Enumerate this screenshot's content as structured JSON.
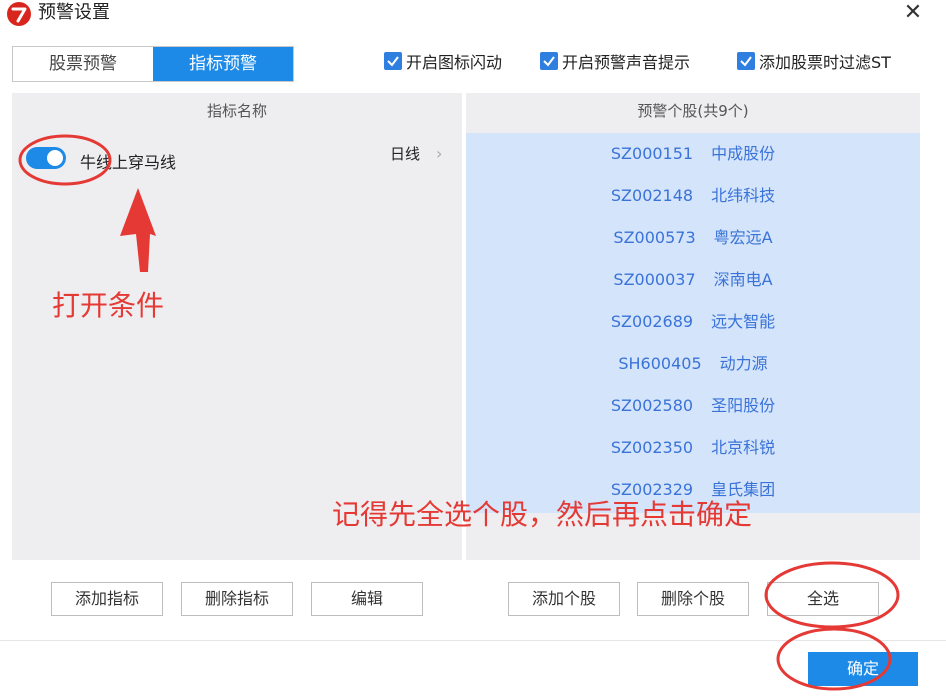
{
  "window": {
    "title": "预警设置",
    "close_glyph": "✕"
  },
  "tabs": [
    {
      "label": "股票预警",
      "active": false
    },
    {
      "label": "指标预警",
      "active": true
    }
  ],
  "options": [
    {
      "label": "开启图标闪动",
      "checked": true
    },
    {
      "label": "开启预警声音提示",
      "checked": true
    },
    {
      "label": "添加股票时过滤ST",
      "checked": true
    }
  ],
  "indicators": {
    "header": "指标名称",
    "items": [
      {
        "name": "牛线上穿马线",
        "period": "日线",
        "enabled": true
      }
    ]
  },
  "stocks": {
    "header": "预警个股(共9个)",
    "items": [
      {
        "code": "SZ000151",
        "name": "中成股份"
      },
      {
        "code": "SZ002148",
        "name": "北纬科技"
      },
      {
        "code": "SZ000573",
        "name": "粤宏远A"
      },
      {
        "code": "SZ000037",
        "name": "深南电A"
      },
      {
        "code": "SZ002689",
        "name": "远大智能"
      },
      {
        "code": "SH600405",
        "name": "动力源"
      },
      {
        "code": "SZ002580",
        "name": "圣阳股份"
      },
      {
        "code": "SZ002350",
        "name": "北京科锐"
      },
      {
        "code": "SZ002329",
        "name": "皇氏集团"
      }
    ]
  },
  "buttons": {
    "add_indicator": "添加指标",
    "delete_indicator": "删除指标",
    "edit": "编辑",
    "add_stock": "添加个股",
    "delete_stock": "删除个股",
    "select_all": "全选",
    "confirm": "确定"
  },
  "annotations": {
    "open_condition": "打开条件",
    "instruction": "记得先全选个股，然后再点击确定"
  },
  "colors": {
    "accent": "#1e8ae8",
    "selection": "#d4e4fb",
    "stock_text": "#3a73d8",
    "annotation": "#e53935"
  },
  "icons": {
    "period_chevron": "›",
    "checkmark": "check-icon",
    "app": "app-logo-icon"
  }
}
